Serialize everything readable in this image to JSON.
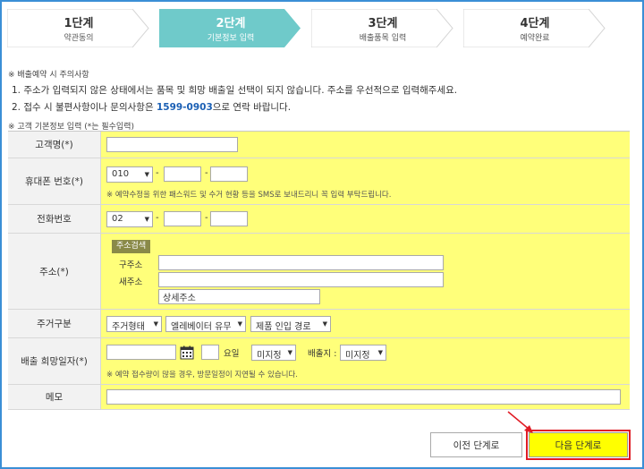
{
  "steps": [
    {
      "num": "1단계",
      "label": "약관동의",
      "active": false
    },
    {
      "num": "2단계",
      "label": "기본정보 입력",
      "active": true
    },
    {
      "num": "3단계",
      "label": "배출품목 입력",
      "active": false
    },
    {
      "num": "4단계",
      "label": "예약완료",
      "active": false
    }
  ],
  "notice": {
    "head": "※ 배출예약 시 주의사항",
    "line1": "1. 주소가 입력되지 않은 상태에서는 품목 및 희망 배출일 선택이 되지 않습니다. 주소를 우선적으로 입력해주세요.",
    "line2_pre": "2. 접수 시 불편사항이나 문의사항은 ",
    "line2_phone": "1599-0903",
    "line2_post": "으로 연락 바랍니다."
  },
  "form_title": "※ 고객 기본정보 입력 (*는 필수입력)",
  "fields": {
    "customer_name": {
      "label": "고객명(*)",
      "value": ""
    },
    "mobile": {
      "label": "휴대폰 번호(*)",
      "prefix": "010",
      "dash": "-",
      "note": "※ 예약수정을 위한 패스워드 및 수거 현황 등을 SMS로 보내드리니 꼭 입력 부탁드립니다."
    },
    "phone": {
      "label": "전화번호",
      "prefix": "02",
      "dash": "-"
    },
    "address": {
      "label": "주소(*)",
      "search_btn": "주소검색",
      "old_label": "구주소",
      "new_label": "새주소",
      "detail_value": "상세주소"
    },
    "housing": {
      "label": "주거구분",
      "type": "주거형태",
      "elevator": "엘레베이터 유무",
      "route": "제품 인입 경로"
    },
    "date": {
      "label": "배출 희망일자(*)",
      "day_label": "요일",
      "time": "미지정",
      "place_label": "배출지 :",
      "place": "미지정",
      "note": "※ 예약 접수량이 많을 경우, 방문일정이 지연될 수 있습니다."
    },
    "memo": {
      "label": "메모"
    }
  },
  "buttons": {
    "prev": "이전 단계로",
    "next": "다음 단계로"
  },
  "colors": {
    "active_step": "#6fcaca",
    "highlight": "#ffff7a",
    "next_button": "#ffff00",
    "callout": "#e01b24"
  }
}
